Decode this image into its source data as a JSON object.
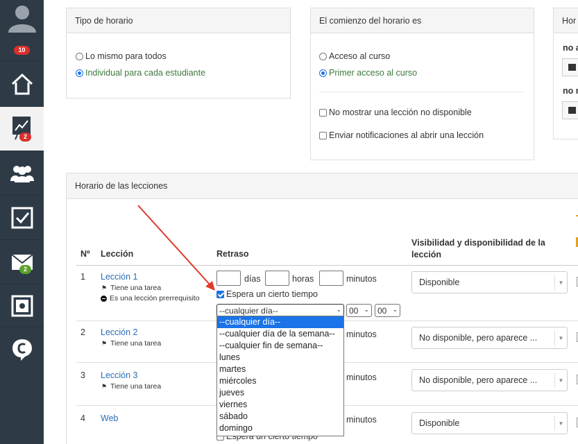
{
  "sidebar": {
    "notifications_badge": "10",
    "reports_badge": "2",
    "messages_badge": "2"
  },
  "schedule_type": {
    "title": "Tipo de horario",
    "option_same": "Lo mismo para todos",
    "option_individual": "Individual para cada estudiante",
    "selected": "Individual para cada estudiante"
  },
  "schedule_start": {
    "title": "El comienzo del horario es",
    "option_course_access": "Acceso al curso",
    "option_first_lesson": "Primer acceso al curso",
    "selected": "Primer acceso al curso",
    "check_hide_unavailable": "No mostrar una lección no disponible",
    "check_notify_open": "Enviar notificaciones al abrir una lección"
  },
  "right_panel": {
    "title": "Hor",
    "label_1": "no a",
    "label_2": "no r"
  },
  "lessons_panel": {
    "title": "Horario de las lecciones",
    "columns": {
      "num": "Nº",
      "lesson": "Lección",
      "delay": "Retraso",
      "visibility": "Visibilidad y disponibilidad de la lección"
    },
    "units": {
      "days": "días",
      "hours": "horas",
      "minutes": "minutos"
    },
    "wait_label": "Espera un cierto tiempo",
    "rows": [
      {
        "num": "1",
        "name": "Lección 1",
        "meta1": "Tiene una tarea",
        "meta2": "Es una lección prerrequisito",
        "visibility": "Disponible"
      },
      {
        "num": "2",
        "name": "Lección 2",
        "meta1": "Tiene una tarea",
        "visibility": "No disponible, pero aparece ..."
      },
      {
        "num": "3",
        "name": "Lección 3",
        "meta1": "Tiene una tarea",
        "visibility": "No disponible, pero aparece ..."
      },
      {
        "num": "4",
        "name": "Web",
        "visibility": "Disponible"
      }
    ],
    "day_select": "--cualquier día--",
    "hour_select": "00",
    "minute_select": "00",
    "day_options": [
      "--cualquier día--",
      "--cualquier día de la semana--",
      "--cualquier fin de semana--",
      "lunes",
      "martes",
      "miércoles",
      "jueves",
      "viernes",
      "sábado",
      "domingo"
    ]
  },
  "colors": {
    "sidebar_bg": "#2e3b47",
    "link": "#2a6db5",
    "accent": "#1a73e8",
    "arrow": "#e0392b"
  }
}
